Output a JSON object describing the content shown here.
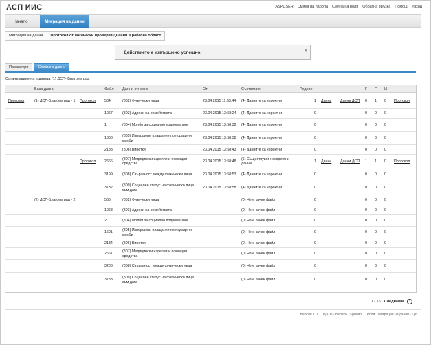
{
  "app": {
    "title": "АСП ИИС"
  },
  "top_links": [
    "ASPUSER",
    "Смяна на парола",
    "Смяна на роля",
    "Обратна връзка",
    "Помощ",
    "Изход"
  ],
  "nav": {
    "home": "Начало",
    "active": "Миграция на данни"
  },
  "breadcrumb": {
    "root": "Миграция на данни",
    "current": "Протокол от логически проверки / Данни в работна област"
  },
  "alert": {
    "message": "Действието е извършено успешно.",
    "close": "×"
  },
  "tabs": {
    "params": "Параметри",
    "list": "Списък с данни"
  },
  "org_unit": "Организационна единица (1) ДСП- Благоевград",
  "table": {
    "headers": {
      "db": "База данни",
      "file": "Файл",
      "data": "Данни относно",
      "from": "От",
      "state": "Състояние",
      "rows": "Редове",
      "g": "Г",
      "p": "П",
      "i": "И"
    },
    "rows": [
      {
        "protocol_a": "Протокол",
        "db": "(1) ДСП-Благоевград - 1",
        "protocol_b": "Протокол",
        "file": "534",
        "data": "(802) Физически лица",
        "from": "23.04.2015 11:53:44",
        "state": "(4) Данните са коректни",
        "rows": "1",
        "data_link": "Данни",
        "dsp_link": "Данни ДСП",
        "g": "0",
        "p": "1",
        "i": "0",
        "protocol_c": "Протокол"
      },
      {
        "protocol_a": "",
        "db": "",
        "protocol_b": "",
        "file": "1067",
        "data": "(803) Адреси на семействата",
        "from": "23.04.2015 13:58:24",
        "state": "(4) Данните са коректни",
        "rows": "0",
        "data_link": "",
        "dsp_link": "",
        "g": "0",
        "p": "0",
        "i": "0",
        "protocol_c": ""
      },
      {
        "protocol_a": "",
        "db": "",
        "protocol_b": "",
        "file": "1",
        "data": "(804) Молби за социално подпомагане",
        "from": "23.04.2015 13:58:32",
        "state": "(4) Данните са коректни",
        "rows": "0",
        "data_link": "",
        "dsp_link": "",
        "g": "0",
        "p": "0",
        "i": "0",
        "protocol_c": ""
      },
      {
        "protocol_a": "",
        "db": "",
        "protocol_b": "",
        "file": "1600",
        "data": "(805) Извършени плащания по подадени молби",
        "from": "23.04.2015 13:58:38",
        "state": "(4) Данните са коректни",
        "rows": "0",
        "data_link": "",
        "dsp_link": "",
        "g": "0",
        "p": "0",
        "i": "0",
        "protocol_c": ""
      },
      {
        "protocol_a": "",
        "db": "",
        "protocol_b": "",
        "file": "2133",
        "data": "(806) Винетки",
        "from": "23.04.2015 13:58:43",
        "state": "(4) Данните са коректни",
        "rows": "0",
        "data_link": "",
        "dsp_link": "",
        "g": "0",
        "p": "0",
        "i": "0",
        "protocol_c": ""
      },
      {
        "protocol_a": "",
        "db": "",
        "protocol_b": "Протокол",
        "file": "2666",
        "data": "(807) Медицински изделия и помощни средства",
        "from": "23.04.2015 13:58:48",
        "state": "(5) Съществуват некоректни данни",
        "rows": "1",
        "data_link": "Данни",
        "dsp_link": "Данни ДСП",
        "g": "1",
        "p": "1",
        "i": "0",
        "protocol_c": "Протокол"
      },
      {
        "protocol_a": "",
        "db": "",
        "protocol_b": "",
        "file": "3199",
        "data": "(808) Свързаност между физически лица",
        "from": "23.04.2015 13:58:53",
        "state": "(4) Данните са коректни",
        "rows": "0",
        "data_link": "",
        "dsp_link": "",
        "g": "0",
        "p": "0",
        "i": "0",
        "protocol_c": ""
      },
      {
        "protocol_a": "",
        "db": "",
        "protocol_b": "",
        "file": "3732",
        "data": "(809) Социален статус на физическо лице към дата",
        "from": "23.04.2015 13:58:58",
        "state": "(4) Данните са коректни",
        "rows": "0",
        "data_link": "",
        "dsp_link": "",
        "g": "0",
        "p": "0",
        "i": "0",
        "protocol_c": ""
      },
      {
        "protocol_a": "",
        "db": "(2) ДСП-Благоевград - 2",
        "protocol_b": "",
        "file": "535",
        "data": "(802) Физически лица",
        "from": "",
        "state": "(0) Не е качен файл",
        "rows": "0",
        "data_link": "",
        "dsp_link": "",
        "g": "0",
        "p": "0",
        "i": "0",
        "protocol_c": ""
      },
      {
        "protocol_a": "",
        "db": "",
        "protocol_b": "",
        "file": "1068",
        "data": "(803) Адреси на семействата",
        "from": "",
        "state": "(0) Не е качен файл",
        "rows": "0",
        "data_link": "",
        "dsp_link": "",
        "g": "0",
        "p": "0",
        "i": "0",
        "protocol_c": ""
      },
      {
        "protocol_a": "",
        "db": "",
        "protocol_b": "",
        "file": "2",
        "data": "(804) Молби за социално подпомагане",
        "from": "",
        "state": "(0) Не е качен файл",
        "rows": "0",
        "data_link": "",
        "dsp_link": "",
        "g": "0",
        "p": "0",
        "i": "0",
        "protocol_c": ""
      },
      {
        "protocol_a": "",
        "db": "",
        "protocol_b": "",
        "file": "1601",
        "data": "(805) Извършени плащания по подадени молби",
        "from": "",
        "state": "(0) Не е качен файл",
        "rows": "0",
        "data_link": "",
        "dsp_link": "",
        "g": "0",
        "p": "0",
        "i": "0",
        "protocol_c": ""
      },
      {
        "protocol_a": "",
        "db": "",
        "protocol_b": "",
        "file": "2134",
        "data": "(806) Винетки",
        "from": "",
        "state": "(0) Не е качен файл",
        "rows": "0",
        "data_link": "",
        "dsp_link": "",
        "g": "0",
        "p": "0",
        "i": "0",
        "protocol_c": ""
      },
      {
        "protocol_a": "",
        "db": "",
        "protocol_b": "",
        "file": "2667",
        "data": "(807) Медицински изделия и помощни средства",
        "from": "",
        "state": "(0) Не е качен файл",
        "rows": "0",
        "data_link": "",
        "dsp_link": "",
        "g": "0",
        "p": "0",
        "i": "0",
        "protocol_c": ""
      },
      {
        "protocol_a": "",
        "db": "",
        "protocol_b": "",
        "file": "3200",
        "data": "(808) Свързаност между физически лица",
        "from": "",
        "state": "(0) Не е качен файл",
        "rows": "0",
        "data_link": "",
        "dsp_link": "",
        "g": "0",
        "p": "0",
        "i": "0",
        "protocol_c": ""
      },
      {
        "protocol_a": "",
        "db": "",
        "protocol_b": "",
        "file": "3733",
        "data": "(809) Социален статус на физическо лице към дата",
        "from": "",
        "state": "(0) Не е качен файл",
        "rows": "0",
        "data_link": "",
        "dsp_link": "",
        "g": "0",
        "p": "0",
        "i": "0",
        "protocol_c": ""
      }
    ]
  },
  "pager": {
    "range": "1 - 16",
    "next": "Следващи",
    "arrow": "›"
  },
  "footer": {
    "version": "Версия 1.0",
    "office": "РДСП - Велико Търново",
    "role": "Роля: \"Миграция на данни - ЦУ\""
  }
}
